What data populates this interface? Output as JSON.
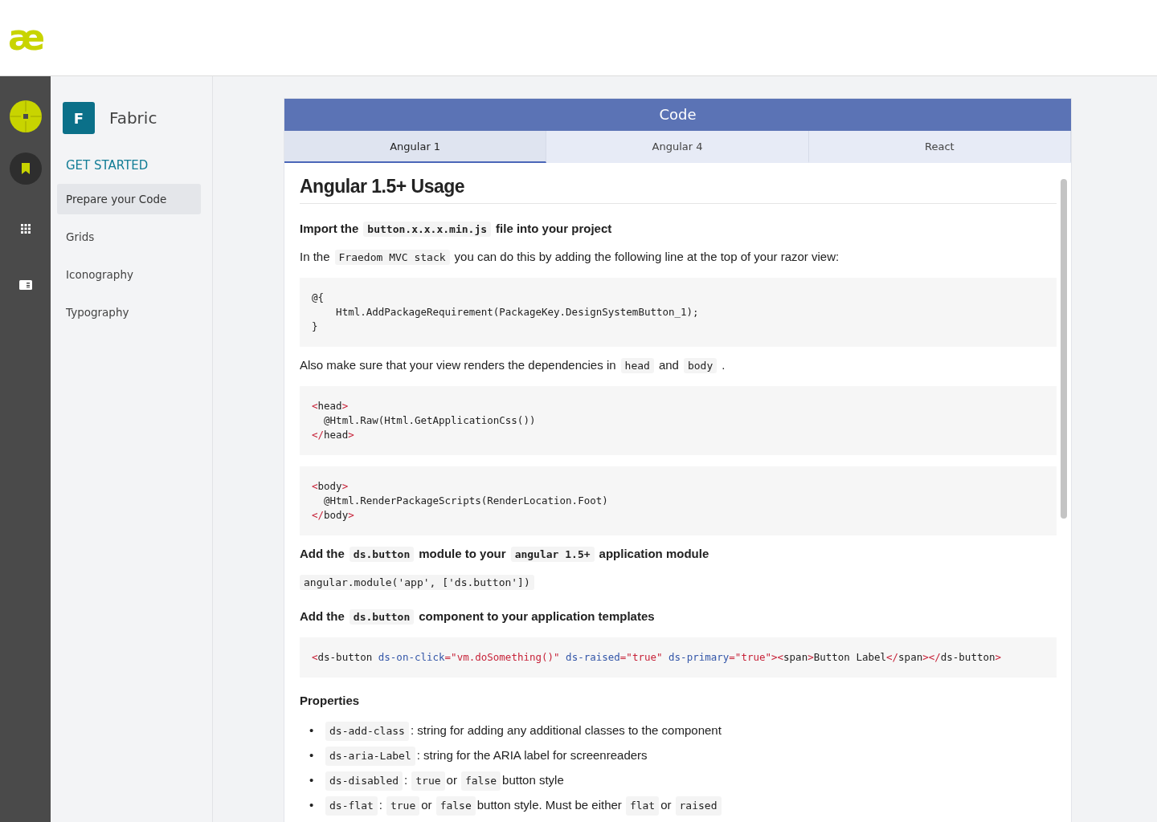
{
  "header": {
    "logo": "æ"
  },
  "sidebar": {
    "badge": "F",
    "title": "Fabric",
    "section": "GET STARTED",
    "items": [
      {
        "label": "Prepare your Code",
        "selected": true
      },
      {
        "label": "Grids",
        "selected": false
      },
      {
        "label": "Iconography",
        "selected": false
      },
      {
        "label": "Typography",
        "selected": false
      }
    ]
  },
  "panel": {
    "title": "Code",
    "tabs": [
      {
        "label": "Angular 1",
        "selected": true
      },
      {
        "label": "Angular 4",
        "selected": false
      },
      {
        "label": "React",
        "selected": false
      }
    ],
    "blocks": [
      {
        "kind": "heading",
        "parts": [
          {
            "kind": "text",
            "text": "Angular 1.5+ Usage"
          }
        ]
      },
      {
        "kind": "subheading",
        "parts": [
          {
            "kind": "text",
            "text": "Import the"
          },
          {
            "kind": "code",
            "text": "button.x.x.x.min.js"
          },
          {
            "kind": "text",
            "text": "file into your project"
          }
        ]
      },
      {
        "kind": "paragraph",
        "parts": [
          {
            "kind": "text",
            "text": "In the"
          },
          {
            "kind": "code",
            "text": "Fraedom MVC stack"
          },
          {
            "kind": "text",
            "text": "you can do this by adding the following line at the top of your razor view:"
          }
        ]
      },
      {
        "kind": "code-block",
        "lines": [
          [
            {
              "kind": "plain",
              "text": "@{"
            }
          ],
          [
            {
              "kind": "plain",
              "text": "    Html.AddPackageRequirement(PackageKey.DesignSystemButton_1);"
            }
          ],
          [
            {
              "kind": "plain",
              "text": "}"
            }
          ]
        ]
      },
      {
        "kind": "paragraph",
        "parts": [
          {
            "kind": "text",
            "text": "Also make sure that your view renders the dependencies in"
          },
          {
            "kind": "code",
            "text": "head"
          },
          {
            "kind": "text",
            "text": "and"
          },
          {
            "kind": "code",
            "text": "body"
          },
          {
            "kind": "text",
            "text": "."
          }
        ]
      },
      {
        "kind": "code-block",
        "lines": [
          [
            {
              "kind": "punct",
              "text": "<"
            },
            {
              "kind": "plain",
              "text": "head"
            },
            {
              "kind": "punct",
              "text": ">"
            }
          ],
          [
            {
              "kind": "plain",
              "text": "  @Html.Raw(Html.GetApplicationCss())"
            }
          ],
          [
            {
              "kind": "punct",
              "text": "</"
            },
            {
              "kind": "plain",
              "text": "head"
            },
            {
              "kind": "punct",
              "text": ">"
            }
          ]
        ]
      },
      {
        "kind": "code-block",
        "lines": [
          [
            {
              "kind": "punct",
              "text": "<"
            },
            {
              "kind": "plain",
              "text": "body"
            },
            {
              "kind": "punct",
              "text": ">"
            }
          ],
          [
            {
              "kind": "plain",
              "text": "  @Html.RenderPackageScripts(RenderLocation.Foot)"
            }
          ],
          [
            {
              "kind": "punct",
              "text": "</"
            },
            {
              "kind": "plain",
              "text": "body"
            },
            {
              "kind": "punct",
              "text": ">"
            }
          ]
        ]
      },
      {
        "kind": "subheading",
        "parts": [
          {
            "kind": "text",
            "text": "Add the"
          },
          {
            "kind": "code",
            "text": "ds.button"
          },
          {
            "kind": "text",
            "text": "module to your"
          },
          {
            "kind": "code",
            "text": "angular 1.5+"
          },
          {
            "kind": "text",
            "text": "application module"
          }
        ]
      },
      {
        "kind": "code-line",
        "parts": [
          {
            "kind": "code",
            "text": "angular.module('app', ['ds.button'])"
          }
        ]
      },
      {
        "kind": "subheading",
        "parts": [
          {
            "kind": "text",
            "text": "Add the"
          },
          {
            "kind": "code",
            "text": "ds.button"
          },
          {
            "kind": "text",
            "text": "component to your application templates"
          }
        ]
      },
      {
        "kind": "code-block",
        "lines": [
          [
            {
              "kind": "punct",
              "text": "<"
            },
            {
              "kind": "plain",
              "text": "ds-button "
            },
            {
              "kind": "attr",
              "text": "ds-on-click"
            },
            {
              "kind": "punct",
              "text": "=\"vm.doSomething()\" "
            },
            {
              "kind": "attr",
              "text": "ds-raised"
            },
            {
              "kind": "punct",
              "text": "=\"true\" "
            },
            {
              "kind": "attr",
              "text": "ds-primary"
            },
            {
              "kind": "punct",
              "text": "=\"true\"><"
            },
            {
              "kind": "plain",
              "text": "span"
            },
            {
              "kind": "punct",
              "text": ">"
            },
            {
              "kind": "plain",
              "text": "Button Label"
            },
            {
              "kind": "punct",
              "text": "</"
            },
            {
              "kind": "plain",
              "text": "span"
            },
            {
              "kind": "punct",
              "text": "></"
            },
            {
              "kind": "plain",
              "text": "ds-button"
            },
            {
              "kind": "punct",
              "text": ">"
            }
          ]
        ]
      },
      {
        "kind": "section",
        "parts": [
          {
            "kind": "text",
            "text": "Properties"
          }
        ]
      },
      {
        "kind": "bullets",
        "marker": "•",
        "items": [
          [
            {
              "kind": "code",
              "text": "ds-add-class"
            },
            {
              "kind": "text",
              "text": ": string for adding any additional classes to the component"
            }
          ],
          [
            {
              "kind": "code",
              "text": "ds-aria-Label"
            },
            {
              "kind": "text",
              "text": ": string for the ARIA label for screenreaders"
            }
          ],
          [
            {
              "kind": "code",
              "text": "ds-disabled"
            },
            {
              "kind": "text",
              "text": ":"
            },
            {
              "kind": "code",
              "text": "true"
            },
            {
              "kind": "text",
              "text": "or"
            },
            {
              "kind": "code",
              "text": "false"
            },
            {
              "kind": "text",
              "text": "button style"
            }
          ],
          [
            {
              "kind": "code",
              "text": "ds-flat"
            },
            {
              "kind": "text",
              "text": ":"
            },
            {
              "kind": "code",
              "text": "true"
            },
            {
              "kind": "text",
              "text": "or"
            },
            {
              "kind": "code",
              "text": "false"
            },
            {
              "kind": "text",
              "text": "button style. Must be either"
            },
            {
              "kind": "code",
              "text": "flat"
            },
            {
              "kind": "text",
              "text": "or"
            },
            {
              "kind": "code",
              "text": "raised"
            }
          ]
        ]
      }
    ]
  }
}
